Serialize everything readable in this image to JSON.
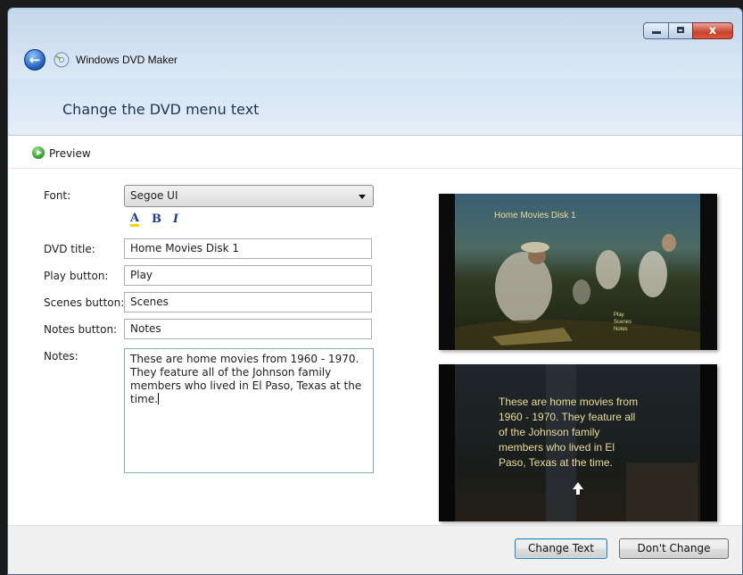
{
  "window": {
    "app_title": "Windows DVD Maker",
    "page_title": "Change the DVD menu text",
    "controls": {
      "minimize": "minimize",
      "maximize": "maximize",
      "close": "x"
    }
  },
  "toolbar": {
    "preview_label": "Preview"
  },
  "form": {
    "font_label": "Font:",
    "font_value": "Segoe UI",
    "format": {
      "color": "A",
      "bold": "B",
      "italic": "I"
    },
    "dvd_title_label": "DVD title:",
    "dvd_title_value": "Home Movies Disk 1",
    "play_label": "Play button:",
    "play_value": "Play",
    "scenes_label": "Scenes button:",
    "scenes_value": "Scenes",
    "notes_button_label": "Notes button:",
    "notes_button_value": "Notes",
    "notes_label": "Notes:",
    "notes_value": "These are home movies from 1960 - 1970.\nThey feature all of the Johnson family\nmembers who lived in El Paso, Texas at the\ntime."
  },
  "preview_menu": {
    "title": "Home Movies Disk 1",
    "items": [
      "Play",
      "Scenes",
      "Notes"
    ]
  },
  "preview_notes": {
    "lines": [
      "These are home movies from",
      "1960 - 1970. They feature all",
      "of the Johnson family",
      "members who lived in El",
      "Paso, Texas at the time."
    ]
  },
  "footer": {
    "change_label": "Change Text",
    "dont_change_label": "Don't Change"
  },
  "colors": {
    "accent": "#3c7fb1",
    "preview_text": "#e9dd9a",
    "title_blue": "#1d3555"
  }
}
